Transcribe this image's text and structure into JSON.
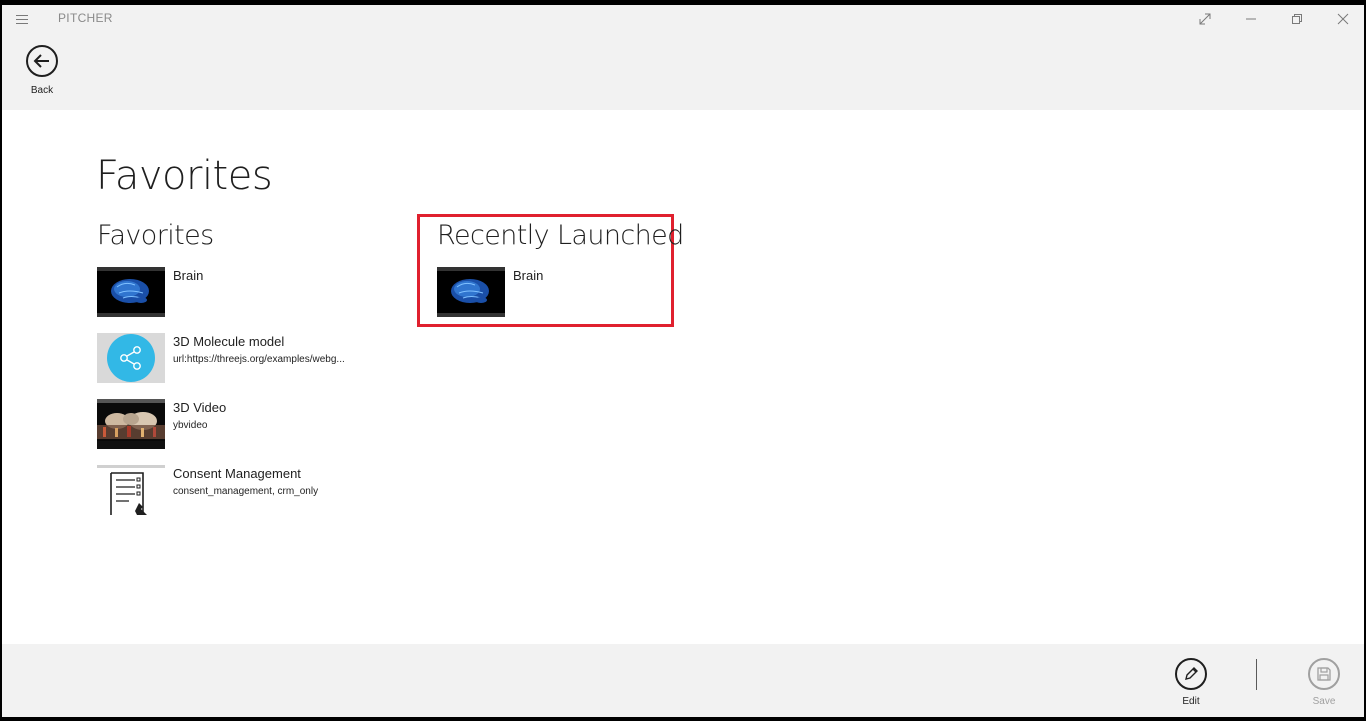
{
  "app": {
    "title": "PITCHER"
  },
  "topbar": {
    "back_label": "Back"
  },
  "page": {
    "title": "Favorites"
  },
  "favorites": {
    "title": "Favorites",
    "items": [
      {
        "title": "Brain",
        "subtitle": "",
        "thumb": "brain-thumbnail"
      },
      {
        "title": "3D Molecule model",
        "subtitle": "url:https://threejs.org/examples/webg...",
        "thumb": "share-icon"
      },
      {
        "title": "3D Video",
        "subtitle": "ybvideo",
        "thumb": "video-thumbnail"
      },
      {
        "title": "Consent Management",
        "subtitle": "consent_management, crm_only",
        "thumb": "document-sign-icon"
      }
    ]
  },
  "recent": {
    "title": "Recently Launched",
    "items": [
      {
        "title": "Brain",
        "subtitle": "",
        "thumb": "brain-thumbnail"
      }
    ]
  },
  "bottombar": {
    "edit_label": "Edit",
    "save_label": "Save"
  },
  "colors": {
    "highlight": "#e0202e",
    "bar_bg": "#f2f2f2",
    "share_blue": "#32b8e6"
  }
}
